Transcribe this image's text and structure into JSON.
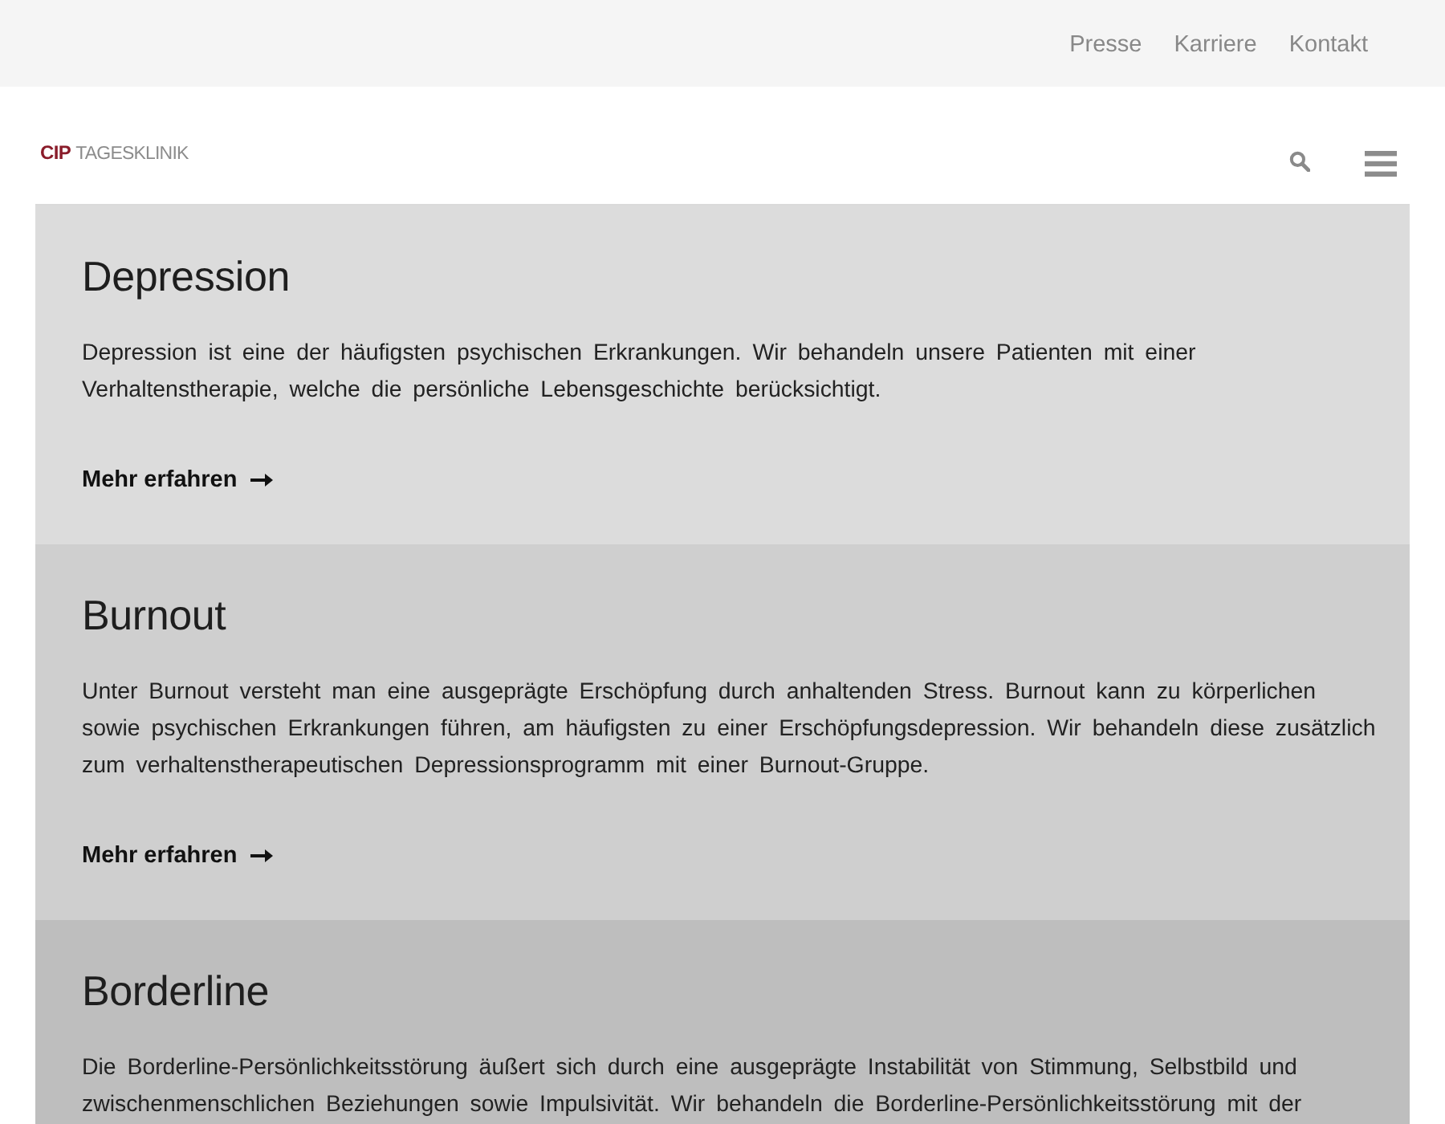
{
  "top_bar": {
    "links": [
      "Presse",
      "Karriere",
      "Kontakt"
    ]
  },
  "header": {
    "logo": {
      "mark": "CIP",
      "name": "TAGESKLINIK"
    }
  },
  "sections": [
    {
      "title": "Depression",
      "text": "Depression ist eine der häufigsten psychischen Erkrankungen. Wir behandeln unsere Patienten mit einer Verhaltenstherapie, welche die persönliche Lebensgeschichte berücksichtigt.",
      "link": "Mehr erfahren",
      "color": "#dcdcdc"
    },
    {
      "title": "Burnout",
      "text": "Unter Burnout versteht man eine ausgeprägte Erschöpfung durch anhaltenden Stress. Burnout kann zu körperlichen sowie psychischen Erkrankungen führen, am häufigsten zu einer Erschöpfungsdepression. Wir behandeln diese zusätzlich zum verhaltenstherapeutischen Depressionsprogramm mit einer Burnout-Gruppe.",
      "link": "Mehr erfahren",
      "color": "#cfcfcf"
    },
    {
      "title": "Borderline",
      "text": "Die Borderline-Persönlichkeitsstörung äußert sich durch eine ausgeprägte Instabilität von Stimmung, Selbstbild und zwischenmenschlichen Beziehungen sowie Impulsivität. Wir behandeln die Borderline-Persönlichkeitsstörung mit der",
      "color": "#bebebe"
    }
  ]
}
